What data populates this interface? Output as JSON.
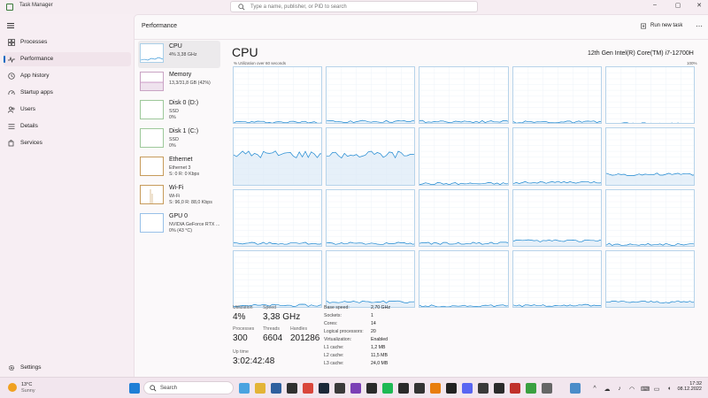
{
  "window": {
    "title": "Task Manager",
    "search_placeholder": "Type a name, publisher, or PID to search"
  },
  "sidebar": {
    "items": [
      {
        "label": "Processes",
        "icon": "grid-icon"
      },
      {
        "label": "Performance",
        "icon": "pulse-icon"
      },
      {
        "label": "App history",
        "icon": "history-icon"
      },
      {
        "label": "Startup apps",
        "icon": "speedometer-icon"
      },
      {
        "label": "Users",
        "icon": "users-icon"
      },
      {
        "label": "Details",
        "icon": "list-icon"
      },
      {
        "label": "Services",
        "icon": "puzzle-icon"
      }
    ],
    "settings_label": "Settings"
  },
  "header": {
    "title": "Performance",
    "run_new_task": "Run new task"
  },
  "devices": [
    {
      "name": "CPU",
      "lines": [
        "4%  3,38 GHz"
      ]
    },
    {
      "name": "Memory",
      "lines": [
        "13,3/31,8 GB (42%)"
      ]
    },
    {
      "name": "Disk 0 (D:)",
      "lines": [
        "SSD",
        "0%"
      ]
    },
    {
      "name": "Disk 1 (C:)",
      "lines": [
        "SSD",
        "0%"
      ]
    },
    {
      "name": "Ethernet",
      "lines": [
        "Ethernet 3",
        "S: 0  R: 0 Kbps"
      ]
    },
    {
      "name": "Wi-Fi",
      "lines": [
        "Wi-Fi",
        "S: 96,0  R: 88,0 Kbps"
      ]
    },
    {
      "name": "GPU 0",
      "lines": [
        "NVIDIA GeForce RTX ...",
        "0%  (43 °C)"
      ]
    }
  ],
  "cpu": {
    "title": "CPU",
    "model": "12th Gen Intel(R) Core(TM) i7-12700H",
    "util_label": "% Utilization over 60 seconds",
    "max_label": "100%",
    "stats": {
      "utilization_label": "Utilization",
      "utilization": "4%",
      "speed_label": "Speed",
      "speed": "3,38 GHz",
      "processes_label": "Processes",
      "processes": "300",
      "threads_label": "Threads",
      "threads": "6604",
      "handles_label": "Handles",
      "handles": "201286",
      "uptime_label": "Up time",
      "uptime": "3:02:42:48"
    },
    "specs": [
      {
        "k": "Base speed:",
        "v": "2,70 GHz"
      },
      {
        "k": "Sockets:",
        "v": "1"
      },
      {
        "k": "Cores:",
        "v": "14"
      },
      {
        "k": "Logical processors:",
        "v": "20"
      },
      {
        "k": "Virtualization:",
        "v": "Enabled"
      },
      {
        "k": "L1 cache:",
        "v": "1,2 MB"
      },
      {
        "k": "L2 cache:",
        "v": "11,5 MB"
      },
      {
        "k": "L3 cache:",
        "v": "24,0 MB"
      }
    ],
    "core_levels": [
      [
        0.05,
        0.06,
        0.06,
        0.05,
        0.02,
        0.55
      ],
      [
        0.55,
        0.55,
        0.04,
        0.06,
        0.2,
        0.3
      ],
      [
        0.08,
        0.08,
        0.08,
        0.12,
        0.06,
        0.06
      ],
      [
        0.06,
        0.12,
        0.05,
        0.06,
        0.12,
        0.06
      ]
    ]
  },
  "taskbar": {
    "temperature": "13°C",
    "condition": "Sunny",
    "search_label": "Search",
    "time": "17:32",
    "date": "08.12.2022",
    "apps": [
      {
        "icon": "windows-start-icon",
        "color": "#1f7fd6"
      },
      {
        "icon": "widgets-icon",
        "color": "#4aa3e0"
      },
      {
        "icon": "file-explorer-icon",
        "color": "#e3b437"
      },
      {
        "icon": "store-icon",
        "color": "#2f5f9e"
      },
      {
        "icon": "back-arrow-app-icon",
        "color": "#303030"
      },
      {
        "icon": "chrome-icon",
        "color": "#d9463b"
      },
      {
        "icon": "steam-icon",
        "color": "#1b2838"
      },
      {
        "icon": "obs-icon",
        "color": "#3a3a3a"
      },
      {
        "icon": "purple-app-icon",
        "color": "#7b3fb5"
      },
      {
        "icon": "notes-app-icon",
        "color": "#2a2a2a"
      },
      {
        "icon": "spotify-icon",
        "color": "#1db954"
      },
      {
        "icon": "game-app-icon",
        "color": "#2a2a2a"
      },
      {
        "icon": "terminal-icon",
        "color": "#333333"
      },
      {
        "icon": "blender-icon",
        "color": "#e87d0d"
      },
      {
        "icon": "unity-icon",
        "color": "#222222"
      },
      {
        "icon": "discord-icon",
        "color": "#5865f2"
      },
      {
        "icon": "tool-app-icon",
        "color": "#3a3a3a"
      },
      {
        "icon": "ide-app-icon",
        "color": "#2b2b2b"
      },
      {
        "icon": "red-app-icon",
        "color": "#c0302a"
      },
      {
        "icon": "green-app-icon",
        "color": "#3aa040"
      },
      {
        "icon": "settings-app-icon",
        "color": "#666666"
      },
      {
        "icon": "task-manager-icon",
        "color": "#4a8cc9"
      }
    ]
  },
  "colors": {
    "accent": "#0067c0",
    "cpu_line": "#1a86d0",
    "cpu_fill": "#dbeaf6"
  }
}
